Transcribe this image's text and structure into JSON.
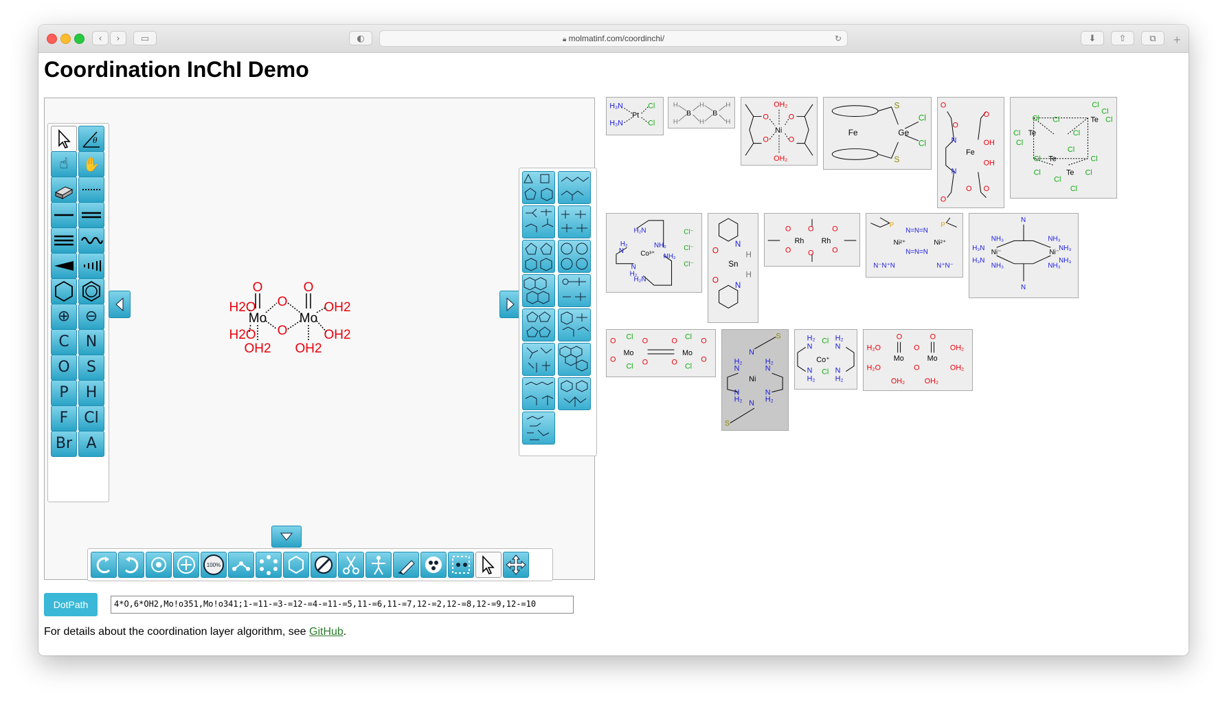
{
  "browser": {
    "url": "molmatinf.com/coordinchi/"
  },
  "page": {
    "title": "Coordination InChI Demo",
    "dotpath_button": "DotPath",
    "dotpath_value": "4*O,6*OH2,Mo!o351,Mo!o341;1-=11-=3-=12-=4-=11-=5,11-=6,11-=7,12-=2,12-=8,12-=9,12-=10",
    "footer_prefix": "For details about the coordination layer algorithm, see ",
    "footer_link": "GitHub",
    "footer_suffix": "."
  },
  "toolbar_left": {
    "elements": [
      "C",
      "N",
      "O",
      "S",
      "P",
      "H",
      "F",
      "Cl",
      "Br",
      "A"
    ]
  },
  "bottom_toolbar": {
    "zoom_label": "100%"
  },
  "molecule": {
    "atoms": [
      "H2O",
      "H2O",
      "Mo",
      "Mo",
      "O",
      "O",
      "O",
      "O",
      "OH2",
      "OH2",
      "OH2",
      "OH2",
      "OH2"
    ]
  },
  "gallery": [
    {
      "id": "pt-cl2-nh3"
    },
    {
      "id": "diborane"
    },
    {
      "id": "ni-acac"
    },
    {
      "id": "ferrocene-ge"
    },
    {
      "id": "fe-edta"
    },
    {
      "id": "te-cl-cluster"
    },
    {
      "id": "co-tren"
    },
    {
      "id": "sn-pyridinone"
    },
    {
      "id": "rh-acetate"
    },
    {
      "id": "ni-azide"
    },
    {
      "id": "ni-cyanide"
    },
    {
      "id": "mo-oxalate"
    },
    {
      "id": "ni-thiocyanate"
    },
    {
      "id": "co-ethylenediamine"
    },
    {
      "id": "mo-dimer"
    }
  ],
  "colors": {
    "accent": "#2aa3c6",
    "oxygen": "#e8000b",
    "nitrogen": "#1a1adf",
    "chlorine": "#11aa11",
    "sulfur": "#8a8a00"
  }
}
